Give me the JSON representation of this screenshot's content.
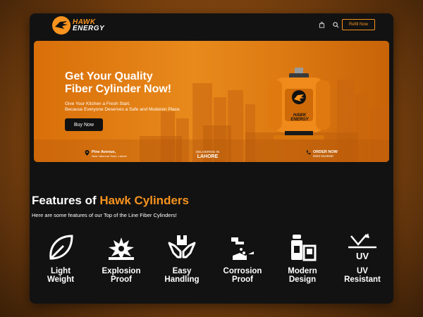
{
  "brand": {
    "line1": "HAWK",
    "line2": "ENERGY"
  },
  "header": {
    "refill_label": "Refill Now"
  },
  "hero": {
    "title_line1": "Get Your Quality",
    "title_line2": "Fiber Cylinder Now!",
    "subtitle_line1": "Give Your Kitchen a Fresh Start.",
    "subtitle_line2": "Because Everyone Deserves a Safe and Moderen Place.",
    "cta": "Buy Now",
    "cylinder_brand_1": "HAWK",
    "cylinder_brand_2": "ENERGY",
    "info": [
      {
        "icon": "location-pin-icon",
        "title": "Pine Avenue,",
        "detail": "Near Valencia Town, Lahore"
      },
      {
        "icon": "",
        "title": "DELIVERING IN",
        "detail": "LAHORE"
      },
      {
        "icon": "phone-icon",
        "title": "ORDER NOW",
        "detail": "0322 8124640"
      }
    ]
  },
  "features": {
    "title_prefix": "Features of",
    "title_accent": "Hawk Cylinders",
    "subtitle": "Here are some features of our Top of the Line Fiber Cylinders!",
    "items": [
      {
        "line1": "Light",
        "line2": "Weight",
        "icon": "leaf-icon"
      },
      {
        "line1": "Explosion",
        "line2": "Proof",
        "icon": "explosion-icon"
      },
      {
        "line1": "Easy",
        "line2": "Handling",
        "icon": "hands-box-icon"
      },
      {
        "line1": "Corrosion",
        "line2": "Proof",
        "icon": "corrosion-icon"
      },
      {
        "line1": "Modern",
        "line2": "Design",
        "icon": "kitchen-icon"
      },
      {
        "line1": "UV",
        "line2": "Resistant",
        "icon": "uv-icon"
      }
    ]
  },
  "colors": {
    "accent": "#f7931e",
    "background": "#121212"
  }
}
